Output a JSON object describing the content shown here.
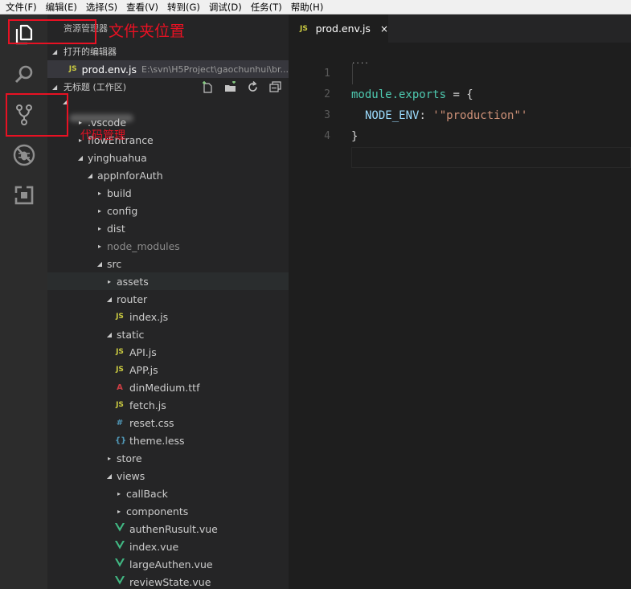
{
  "menu": [
    "文件(F)",
    "编辑(E)",
    "选择(S)",
    "查看(V)",
    "转到(G)",
    "调试(D)",
    "任务(T)",
    "帮助(H)"
  ],
  "activity_icons": [
    "explorer-icon",
    "search-icon",
    "source-control-icon",
    "debug-icon",
    "extensions-icon"
  ],
  "sidebar": {
    "title": "资源管理器",
    "open_editors_header": "打开的编辑器",
    "open_editor": {
      "badge": "JS",
      "name": "prod.env.js",
      "path": "E:\\svn\\H5Project\\gaochunhui\\br..."
    },
    "workspace_header": "无标题 (工作区)",
    "workspace_actions": [
      "new-file-icon",
      "new-folder-icon",
      "refresh-icon",
      "collapse-all-icon"
    ]
  },
  "tree": [
    {
      "label": ".vscode",
      "twisty": "▸"
    },
    {
      "label": "flowEntrance",
      "twisty": "▸"
    },
    {
      "label": "yinghuahua",
      "twisty": "◢"
    },
    {
      "label": "appInforAuth",
      "twisty": "◢"
    },
    {
      "label": "build",
      "twisty": "▸"
    },
    {
      "label": "config",
      "twisty": "▸"
    },
    {
      "label": "dist",
      "twisty": "▸"
    },
    {
      "label": "node_modules",
      "twisty": "▸"
    },
    {
      "label": "src",
      "twisty": "◢"
    },
    {
      "label": "assets",
      "twisty": "▸"
    },
    {
      "label": "router",
      "twisty": "◢"
    },
    {
      "label": "index.js",
      "icon": "JS"
    },
    {
      "label": "static",
      "twisty": "◢"
    },
    {
      "label": "API.js",
      "icon": "JS"
    },
    {
      "label": "APP.js",
      "icon": "JS"
    },
    {
      "label": "dinMedium.ttf",
      "icon": "A"
    },
    {
      "label": "fetch.js",
      "icon": "JS"
    },
    {
      "label": "reset.css",
      "icon": "#"
    },
    {
      "label": "theme.less",
      "icon": "{}"
    },
    {
      "label": "store",
      "twisty": "▸"
    },
    {
      "label": "views",
      "twisty": "◢"
    },
    {
      "label": "callBack",
      "twisty": "▸"
    },
    {
      "label": "components",
      "twisty": "▸"
    },
    {
      "label": "authenRusult.vue",
      "icon": "vue"
    },
    {
      "label": "index.vue",
      "icon": "vue"
    },
    {
      "label": "largeAuthen.vue",
      "icon": "vue"
    },
    {
      "label": "reviewState.vue",
      "icon": "vue"
    }
  ],
  "editor": {
    "tab": {
      "badge": "JS",
      "name": "prod.env.js",
      "close": "×"
    },
    "line_numbers": [
      "1",
      "2",
      "3",
      "4"
    ],
    "code": {
      "l1_a": "module",
      "l1_b": ".exports",
      "l1_c": " = {",
      "l2_key": "NODE_ENV",
      "l2_colon": ": ",
      "l2_val": "'\"production\"'",
      "l3": "}",
      "dots": "...."
    }
  },
  "annotations": {
    "folder_location": "文件夹位置",
    "code_management": "代码管理",
    "color": "#e81123"
  },
  "colors": {
    "activity_bar": "#2c2c2c",
    "sidebar": "#252526",
    "editor": "#1e1e1e",
    "vue_green": "#41b883",
    "js_yellow": "#cbcb41"
  }
}
